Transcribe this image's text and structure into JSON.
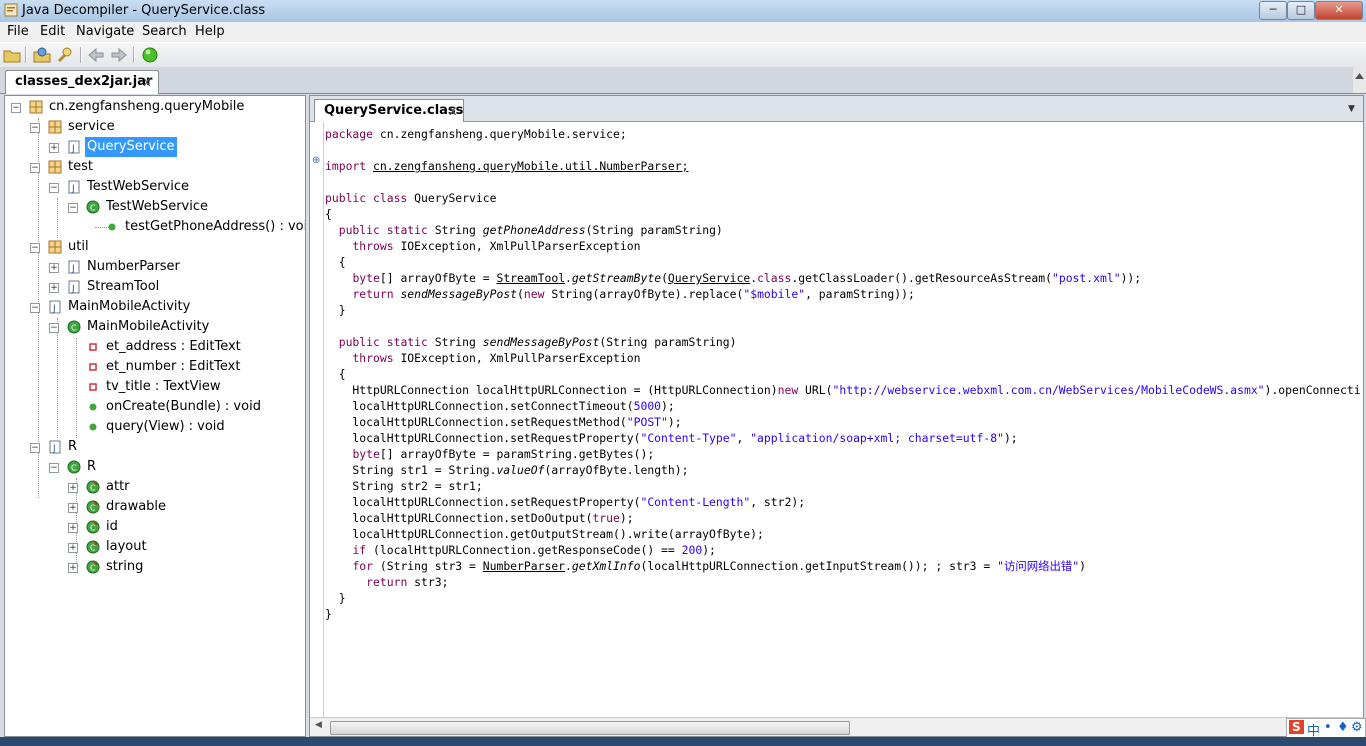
{
  "window": {
    "title": "Java Decompiler - QueryService.class",
    "min": "─",
    "max": "□",
    "close": "✕"
  },
  "menu": [
    "File",
    "Edit",
    "Navigate",
    "Search",
    "Help"
  ],
  "outer_tab": {
    "label": "classes_dex2jar.jar",
    "close": "x"
  },
  "inner_tab": {
    "label": "QueryService.class",
    "close": "x"
  },
  "tree": {
    "root": "cn.zengfansheng.queryMobile",
    "nodes": [
      "service",
      "QueryService",
      "test",
      "TestWebService",
      "TestWebService",
      "testGetPhoneAddress() : void",
      "util",
      "NumberParser",
      "StreamTool",
      "MainMobileActivity",
      "MainMobileActivity",
      "et_address : EditText",
      "et_number : EditText",
      "tv_title : TextView",
      "onCreate(Bundle) : void",
      "query(View) : void",
      "R",
      "R",
      "attr",
      "drawable",
      "id",
      "layout",
      "string"
    ]
  },
  "code": {
    "package_line": "cn.zengfansheng.queryMobile.service;",
    "import_line": "cn.zengfansheng.queryMobile.util.NumberParser;",
    "class_name": "QueryService",
    "url": "\"http://webservice.webxml.com.cn/WebServices/MobileCodeWS.asmx\"",
    "post_xml": "\"post.xml\"",
    "mobile": "\"$mobile\"",
    "timeout": "5000",
    "method": "\"POST\"",
    "content_type": "\"Content-Type\"",
    "content_type_val": "\"application/soap+xml; charset=utf-8\"",
    "content_length": "\"Content-Length\"",
    "resp_code": "200",
    "error_str": "\"访问网络出错\""
  },
  "ime": [
    "S",
    "中",
    "•",
    "♦",
    "⚙"
  ]
}
